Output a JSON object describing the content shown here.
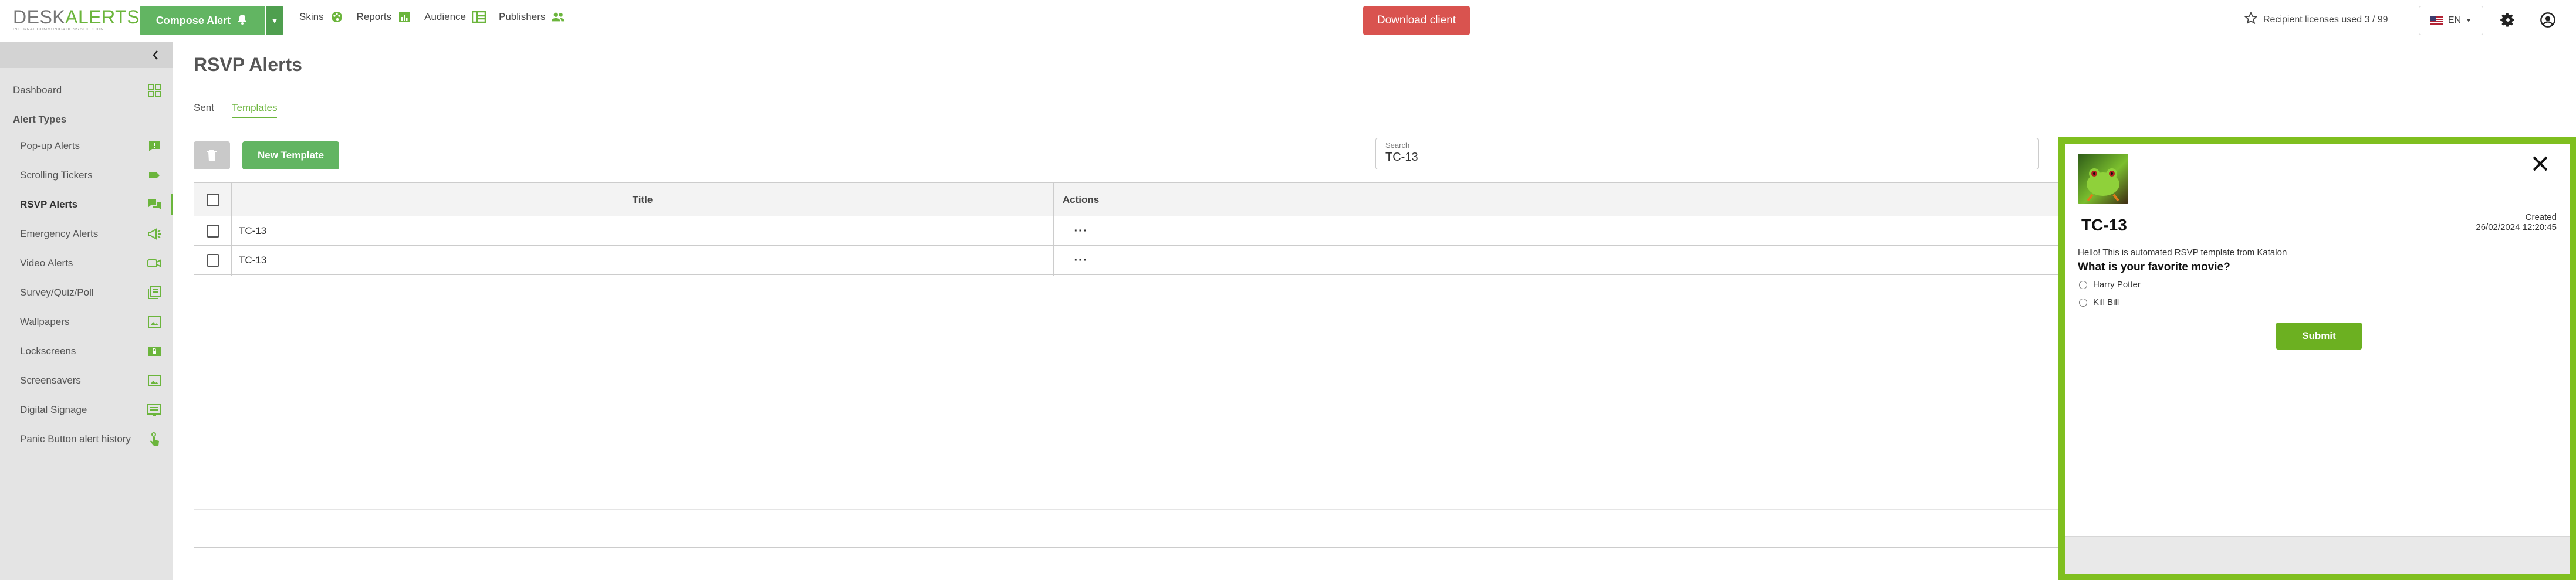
{
  "header": {
    "logo_main_a": "DESK",
    "logo_main_b": "ALERTS",
    "logo_sub": "INTERNAL COMMUNICATIONS SOLUTION",
    "compose_label": "Compose Alert",
    "nav": [
      {
        "label": "Skins",
        "icon": "palette-icon"
      },
      {
        "label": "Reports",
        "icon": "chart-icon"
      },
      {
        "label": "Audience",
        "icon": "org-table-icon"
      },
      {
        "label": "Publishers",
        "icon": "people-icon"
      }
    ],
    "download_label": "Download client",
    "licenses_label": "Recipient licenses used 3 / 99",
    "lang_label": "EN",
    "accent_color": "#6bb53c",
    "danger_color": "#d9534f"
  },
  "sidebar": {
    "dashboard_label": "Dashboard",
    "section_heading": "Alert Types",
    "items": [
      {
        "label": "Pop-up Alerts",
        "icon": "popup-icon"
      },
      {
        "label": "Scrolling Tickers",
        "icon": "ticker-icon"
      },
      {
        "label": "RSVP Alerts",
        "icon": "rsvp-chat-icon",
        "active": true
      },
      {
        "label": "Emergency Alerts",
        "icon": "megaphone-icon"
      },
      {
        "label": "Video Alerts",
        "icon": "video-icon"
      },
      {
        "label": "Survey/Quiz/Poll",
        "icon": "survey-icon"
      },
      {
        "label": "Wallpapers",
        "icon": "wallpaper-icon"
      },
      {
        "label": "Lockscreens",
        "icon": "lockscreen-icon"
      },
      {
        "label": "Screensavers",
        "icon": "screensaver-icon"
      },
      {
        "label": "Digital Signage",
        "icon": "signage-icon"
      },
      {
        "label": "Panic Button alert history",
        "icon": "panic-hand-icon"
      }
    ]
  },
  "main": {
    "title": "RSVP Alerts",
    "tabs": [
      {
        "label": "Sent",
        "active": false
      },
      {
        "label": "Templates",
        "active": true
      }
    ],
    "new_template_label": "New Template",
    "search": {
      "label": "Search",
      "value": "TC-13"
    },
    "table": {
      "columns": [
        "Title",
        "Actions"
      ],
      "rows": [
        {
          "title": "TC-13",
          "actions": "···"
        },
        {
          "title": "TC-13",
          "actions": "···"
        }
      ]
    }
  },
  "preview": {
    "title": "TC-13",
    "created_label": "Created",
    "created_date": "26/02/2024 12:20:45",
    "text": "Hello! This is automated RSVP template from Katalon",
    "question": "What is your favorite movie?",
    "options": [
      "Harry Potter",
      "Kill Bill"
    ],
    "submit_label": "Submit",
    "border_color": "#7fbf1f"
  }
}
